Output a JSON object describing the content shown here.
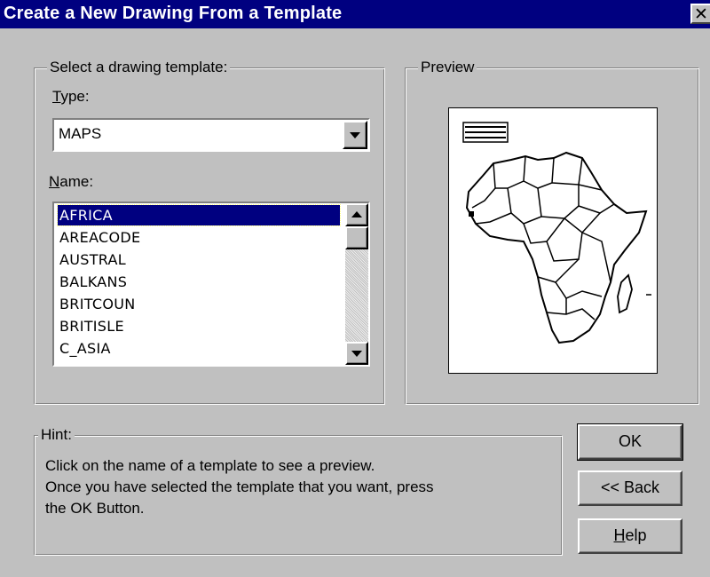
{
  "window": {
    "title": "Create a New Drawing From a Template",
    "close_symbol": "✕"
  },
  "select_group": {
    "legend": "Select a drawing template:",
    "type_label_accel": "T",
    "type_label_rest": "ype:",
    "type_value": "MAPS",
    "name_label_accel": "N",
    "name_label_rest": "ame:",
    "items": [
      {
        "label": "AFRICA",
        "selected": true
      },
      {
        "label": "AREACODE",
        "selected": false
      },
      {
        "label": "AUSTRAL",
        "selected": false
      },
      {
        "label": "BALKANS",
        "selected": false
      },
      {
        "label": "BRITCOUN",
        "selected": false
      },
      {
        "label": "BRITISLE",
        "selected": false
      },
      {
        "label": "C_ASIA",
        "selected": false
      }
    ]
  },
  "preview_group": {
    "legend": "Preview",
    "image": "africa-map-thumbnail"
  },
  "hint_group": {
    "legend": "Hint:",
    "lines": [
      "Click on the name of a template to see a preview.",
      "Once you have selected the template that you want, press",
      "the OK Button."
    ]
  },
  "buttons": {
    "ok": "OK",
    "back": "<< Back",
    "help_accel": "H",
    "help_rest": "elp"
  },
  "colors": {
    "titlebar": "#000080",
    "face": "#c0c0c0",
    "selection": "#000080"
  }
}
